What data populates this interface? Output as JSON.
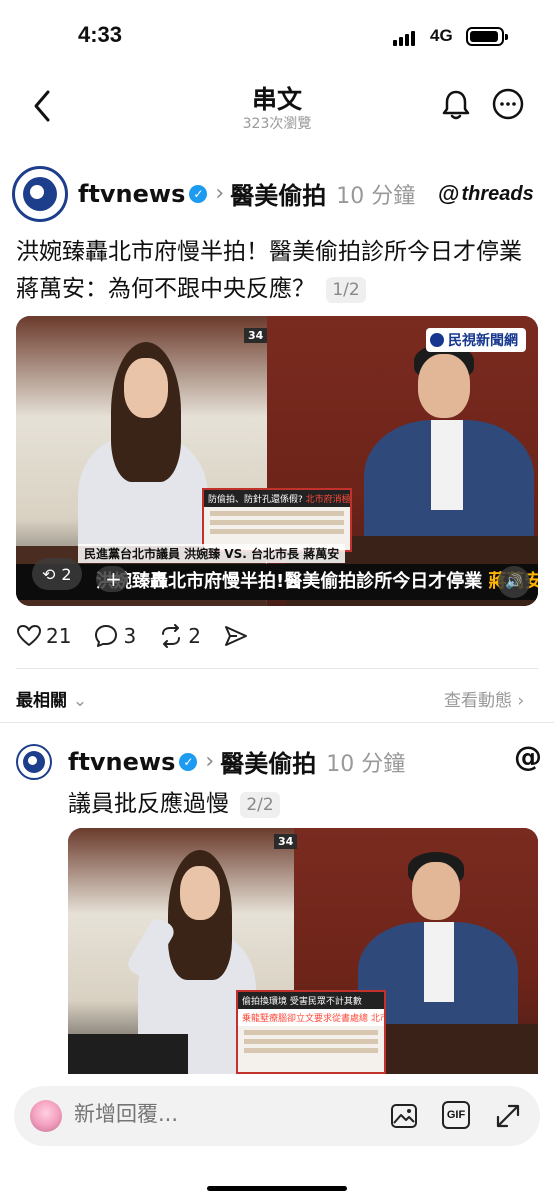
{
  "status_bar": {
    "time": "4:33",
    "network": "4G"
  },
  "header": {
    "title": "串文",
    "views": "323次瀏覽"
  },
  "post1": {
    "username": "ftvnews",
    "topic": "醫美偷拍",
    "time": "10 分鐘",
    "threads_label": "threads",
    "text": "洪婉臻轟北市府慢半拍！醫美偷拍診所今日才停業　蔣萬安：為何不跟中央反應？",
    "page": "1/2",
    "media": {
      "logo": "民視新聞網",
      "room_label": "34",
      "doc_title": "防偷拍、防針孔還係假?",
      "doc_title_highlight": "北市府消極作為成共犯?!",
      "caption": "民進黨台北市議員 洪婉臻 VS. 台北市長 蔣萬安",
      "headline": "洪婉臻轟北市府慢半拍!醫美偷拍診所今日才停業",
      "headline_yellow": "蔣萬安:為何不跟中央反應?",
      "repost_count": "2"
    },
    "likes": "21",
    "replies": "3",
    "reposts": "2"
  },
  "sort": {
    "label": "最相關",
    "activity": "查看動態"
  },
  "post2": {
    "username": "ftvnews",
    "topic": "醫美偷拍",
    "time": "10 分鐘",
    "text": "議員批反應過慢",
    "page": "2/2",
    "media": {
      "room_label": "34",
      "doc_title": "偷拍換環境 受害民眾不計其數",
      "doc_title_highlight": "乗龍墅療腦卻立文要求從書處總 北市府假沒看見?!"
    }
  },
  "composer": {
    "placeholder": "新增回覆..."
  }
}
